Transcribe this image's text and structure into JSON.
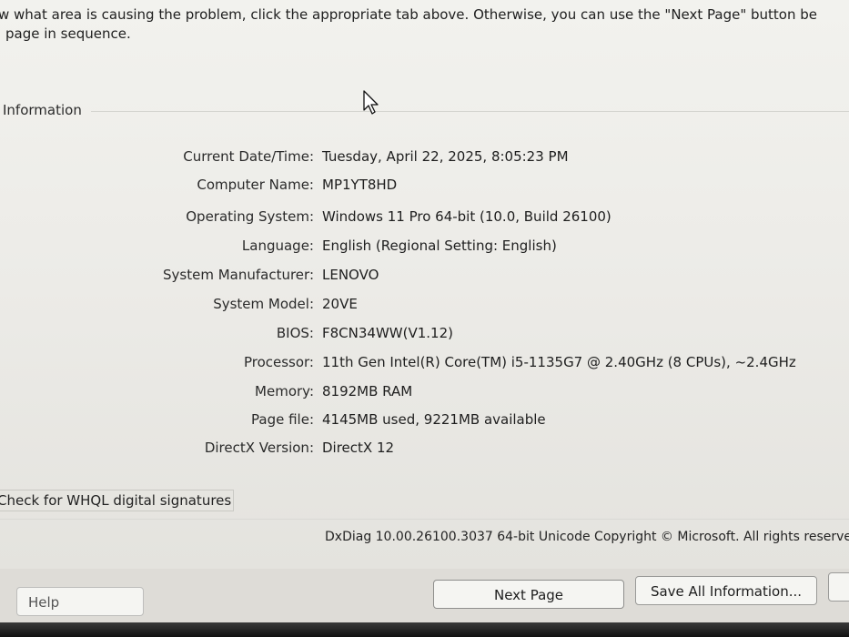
{
  "intro": {
    "line1": "w what area is causing the problem, click the appropriate tab above.  Otherwise, you can use the \"Next Page\" button be",
    "line2": "page in sequence."
  },
  "group": {
    "title": "Information"
  },
  "system_info": [
    {
      "label": "Current Date/Time:",
      "value": "Tuesday, April 22, 2025, 8:05:23 PM"
    },
    {
      "label": "Computer Name:",
      "value": "MP1YT8HD"
    },
    {
      "label": "Operating System:",
      "value": "Windows 11 Pro 64-bit (10.0, Build 26100)"
    },
    {
      "label": "Language:",
      "value": "English (Regional Setting: English)"
    },
    {
      "label": "System Manufacturer:",
      "value": "LENOVO"
    },
    {
      "label": "System Model:",
      "value": "20VE"
    },
    {
      "label": "BIOS:",
      "value": "F8CN34WW(V1.12)"
    },
    {
      "label": "Processor:",
      "value": "11th Gen Intel(R) Core(TM) i5-1135G7 @ 2.40GHz (8 CPUs), ~2.4GHz"
    },
    {
      "label": "Memory:",
      "value": "8192MB RAM"
    },
    {
      "label": "Page file:",
      "value": "4145MB used, 9221MB available"
    },
    {
      "label": "DirectX Version:",
      "value": "DirectX 12"
    }
  ],
  "whql": {
    "label": "Check for WHQL digital signatures"
  },
  "footer": {
    "version_text": "DxDiag 10.00.26100.3037 64-bit Unicode  Copyright © Microsoft. All rights reserve"
  },
  "buttons": {
    "help": "Help",
    "next_page": "Next Page",
    "save_all": "Save All Information..."
  },
  "icons": {
    "cursor": "mouse-pointer-icon"
  }
}
